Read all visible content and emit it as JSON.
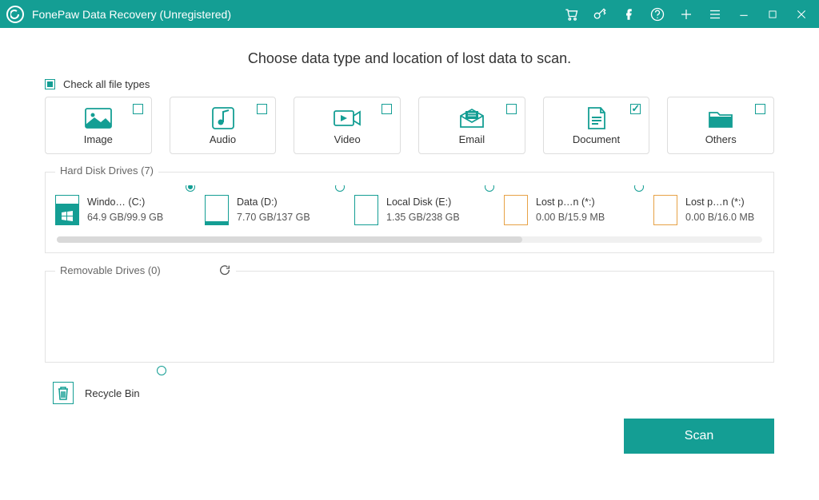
{
  "app": {
    "title": "FonePaw Data Recovery (Unregistered)"
  },
  "heading": "Choose data type and location of lost data to scan.",
  "check_all_label": "Check all file types",
  "tiles": [
    {
      "label": "Image",
      "checked": false
    },
    {
      "label": "Audio",
      "checked": false
    },
    {
      "label": "Video",
      "checked": false
    },
    {
      "label": "Email",
      "checked": false
    },
    {
      "label": "Document",
      "checked": true
    },
    {
      "label": "Others",
      "checked": false
    }
  ],
  "sections": {
    "hdd_legend": "Hard Disk Drives (7)",
    "removable_legend": "Removable Drives (0)"
  },
  "drives": [
    {
      "name": "Windo… (C:)",
      "size": "64.9 GB/99.9 GB",
      "kind": "win",
      "selected": true
    },
    {
      "name": "Data (D:)",
      "size": "7.70 GB/137 GB",
      "kind": "data",
      "selected": false
    },
    {
      "name": "Local Disk (E:)",
      "size": "1.35 GB/238 GB",
      "kind": "plain",
      "selected": false
    },
    {
      "name": "Lost p…n (*:)",
      "size": "0.00  B/15.9 MB",
      "kind": "lost",
      "selected": false
    },
    {
      "name": "Lost p…n (*:)",
      "size": "0.00  B/16.0 MB",
      "kind": "lost",
      "selected": false
    }
  ],
  "recycle": {
    "label": "Recycle Bin"
  },
  "scan_label": "Scan"
}
